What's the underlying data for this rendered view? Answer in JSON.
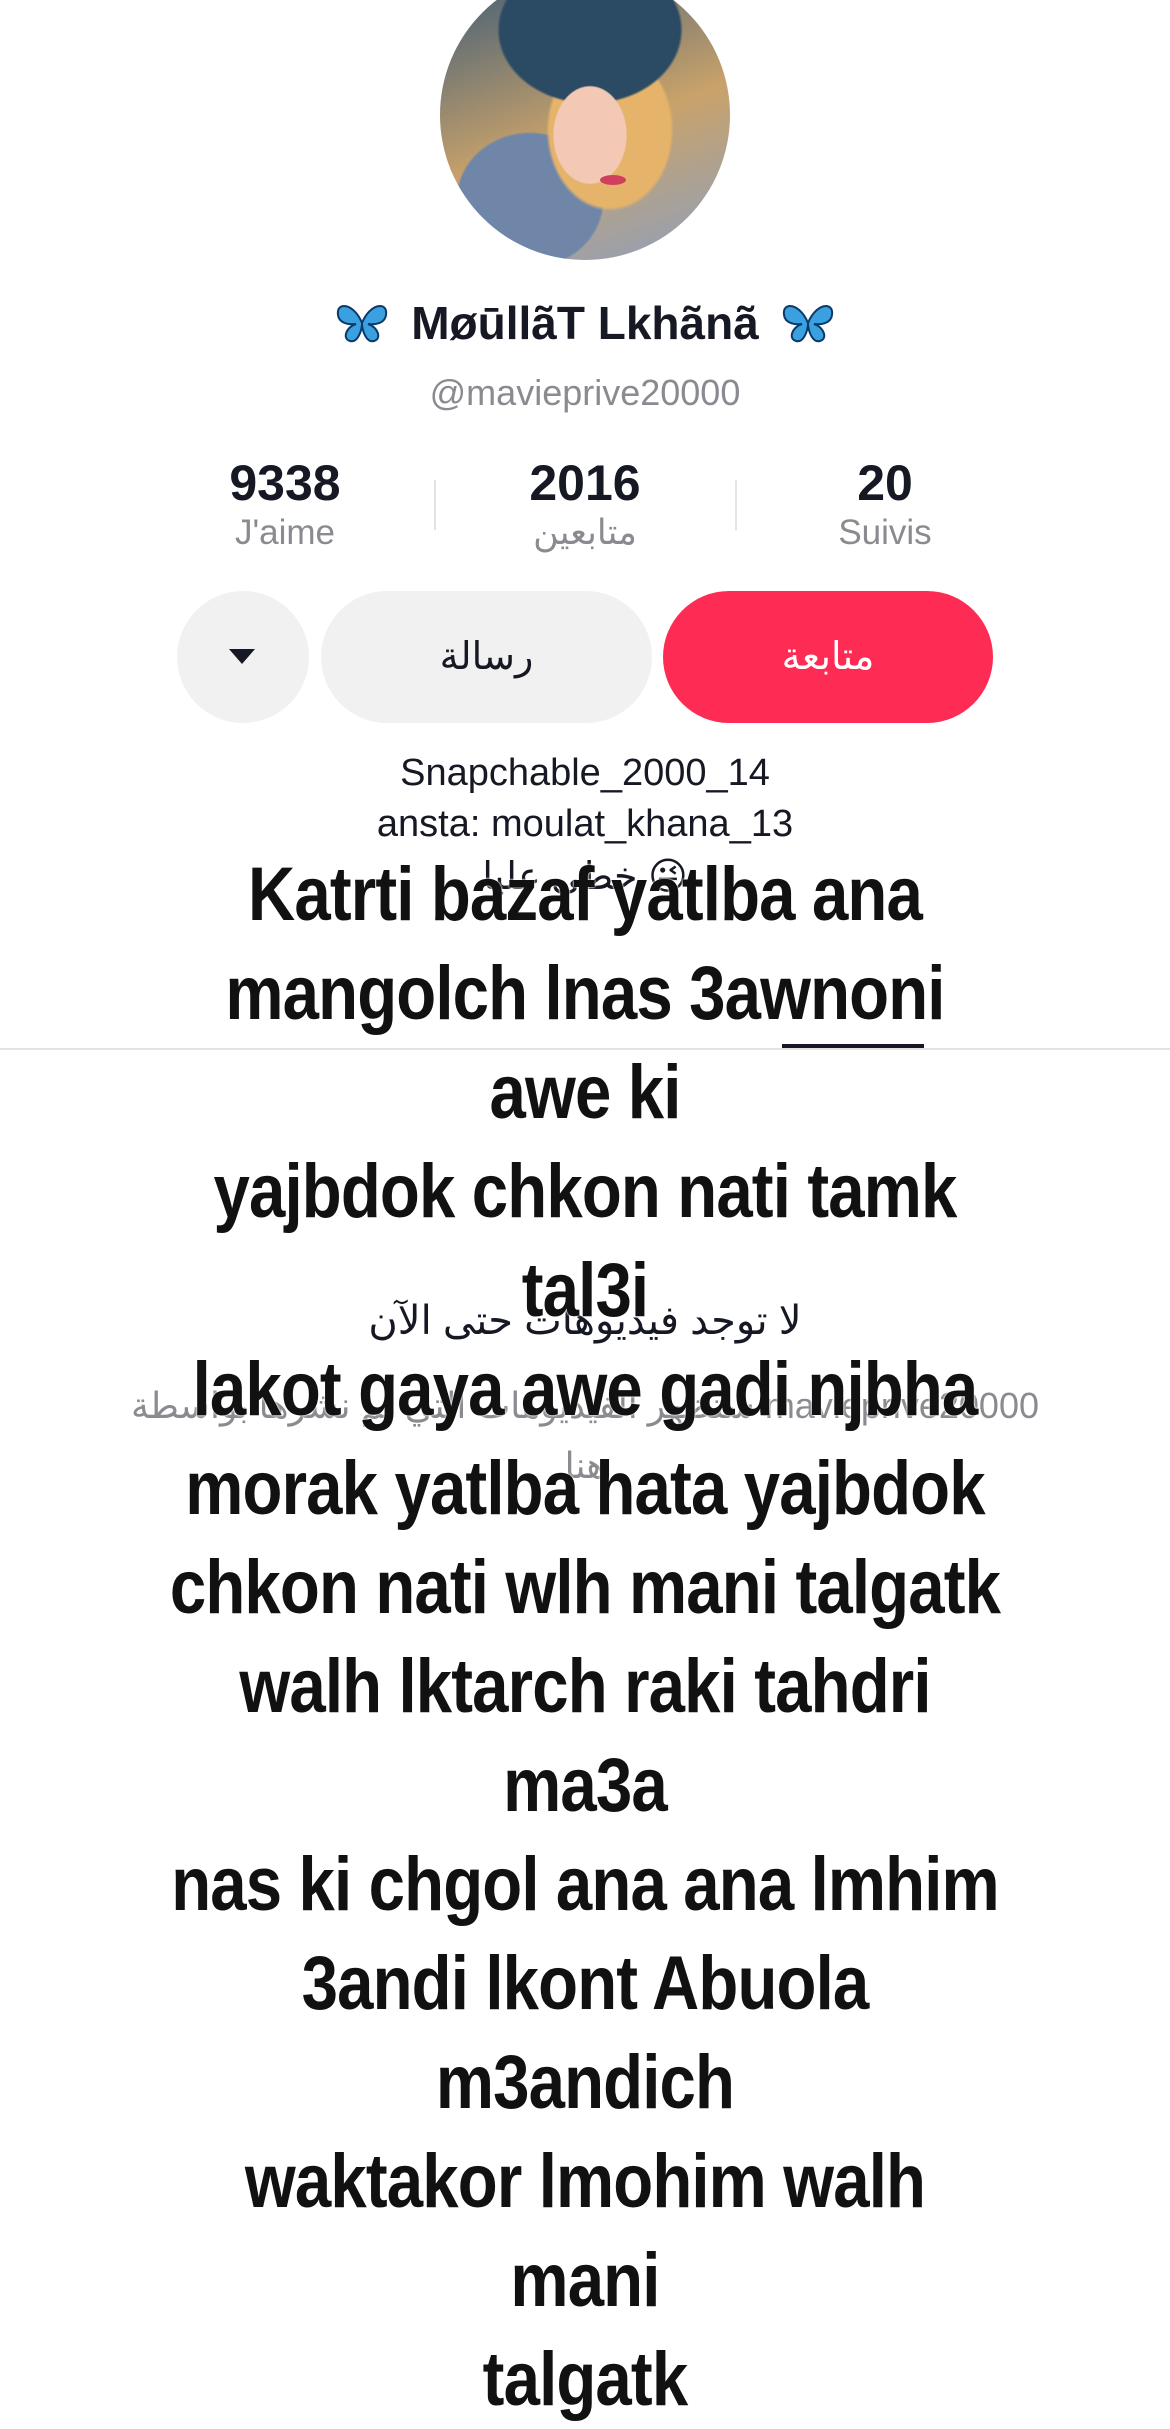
{
  "profile": {
    "display_name": "MøūllãT Lkhãnã",
    "handle": "@mavieprive20000",
    "avatar_icon": "profile-photo",
    "name_decoration_icon": "blue-butterfly-emoji"
  },
  "stats": {
    "likes": {
      "value": "9338",
      "label": "J'aime"
    },
    "followers": {
      "value": "2016",
      "label": "متابعين"
    },
    "following": {
      "value": "20",
      "label": "Suivis"
    }
  },
  "buttons": {
    "more": {
      "icon": "triangle-down-icon"
    },
    "message": "رسالة",
    "follow": "متابعة"
  },
  "colors": {
    "follow_button": "#fe2c55",
    "secondary_button": "#f1f1f2",
    "muted_text": "#8a8b91"
  },
  "bio": {
    "line1": "Snapchable_2000_14",
    "line2": "ansta: moulat_khana_13",
    "line3": "خطي عليا 😜"
  },
  "videos_empty": {
    "title": "لا توجد فيديوهات حتى الآن",
    "subtitle": "ستظهر الفيديوهات التي تم نشرها بواسطة mavieprive20000",
    "subtitle_line2": "هنا"
  },
  "overlay_text": {
    "lines": [
      "Katrti bazaf yatlba ana",
      "mangolch lnas 3awnoni awe ki",
      "yajbdok chkon nati tamk tal3i",
      "lakot gaya awe gadi njbha",
      "morak yatlba hata yajbdok",
      "chkon nati wlh mani talgatk",
      "walh lktarch raki tahdri ma3a",
      "nas ki chgol ana ana lmhim",
      "3andi lkont Abuola m3andich",
      "waktakor lmohim walh mani",
      "talgatk"
    ]
  }
}
